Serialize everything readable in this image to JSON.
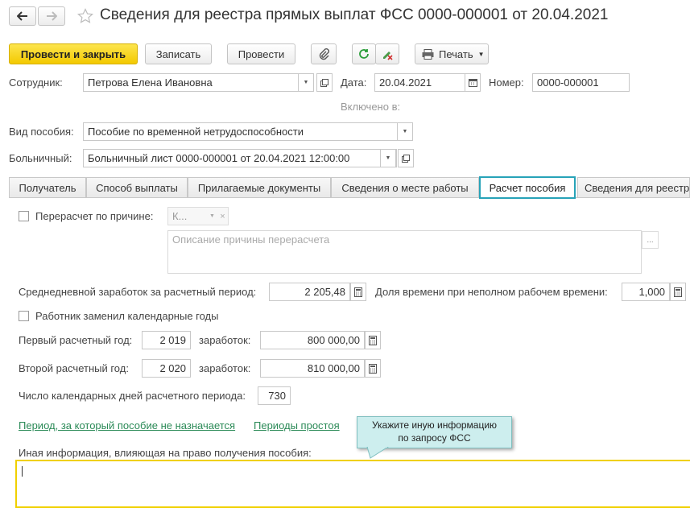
{
  "header": {
    "title": "Сведения для реестра прямых выплат ФСС 0000-000001 от 20.04.2021"
  },
  "toolbar": {
    "post_close": "Провести и закрыть",
    "save": "Записать",
    "post": "Провести",
    "print": "Печать"
  },
  "form": {
    "employee_label": "Сотрудник:",
    "employee_value": "Петрова Елена Ивановна",
    "date_label": "Дата:",
    "date_value": "20.04.2021",
    "number_label": "Номер:",
    "number_value": "0000-000001",
    "included_label": "Включено в:",
    "benefit_type_label": "Вид пособия:",
    "benefit_type_value": "Пособие по временной нетрудоспособности",
    "sick_leave_label": "Больничный:",
    "sick_leave_value": "Больничный лист 0000-000001 от 20.04.2021 12:00:00"
  },
  "tabs": [
    {
      "label": "Получатель"
    },
    {
      "label": "Способ выплаты"
    },
    {
      "label": "Прилагаемые документы"
    },
    {
      "label": "Сведения о месте работы"
    },
    {
      "label": "Расчет пособия"
    },
    {
      "label": "Сведения для реестр"
    }
  ],
  "calc": {
    "recalc_label": "Перерасчет по причине:",
    "recalc_reason_value": "К...",
    "recalc_description_placeholder": "Описание причины перерасчета",
    "more_button": "...",
    "avg_daily_label": "Среднедневной заработок за расчетный период:",
    "avg_daily_value": "2 205,48",
    "part_time_label": "Доля времени при неполном рабочем времени:",
    "part_time_value": "1,000",
    "replaced_years_label": "Работник заменил календарные годы",
    "first_year_label": "Первый расчетный год:",
    "first_year_value": "2 019",
    "earnings_label_1": "заработок:",
    "first_year_earnings": "800 000,00",
    "second_year_label": "Второй расчетный год:",
    "second_year_value": "2 020",
    "earnings_label_2": "заработок:",
    "second_year_earnings": "810 000,00",
    "calendar_days_label": "Число календарных дней расчетного периода:",
    "calendar_days_value": "730",
    "link_not_assigned": "Период, за который пособие не назначается",
    "link_downtime": "Периоды простоя",
    "other_info_label": "Иная информация, влияющая на право получения пособия:",
    "other_info_value": ""
  },
  "tooltip": {
    "text": "Укажите иную информацию по запросу ФСС"
  },
  "colors": {
    "primary_button": "#f3c900",
    "active_tab_border": "#27a3b8",
    "link": "#2b8a57",
    "tooltip_bg": "#cdeeee",
    "focus_border": "#f0d000"
  }
}
